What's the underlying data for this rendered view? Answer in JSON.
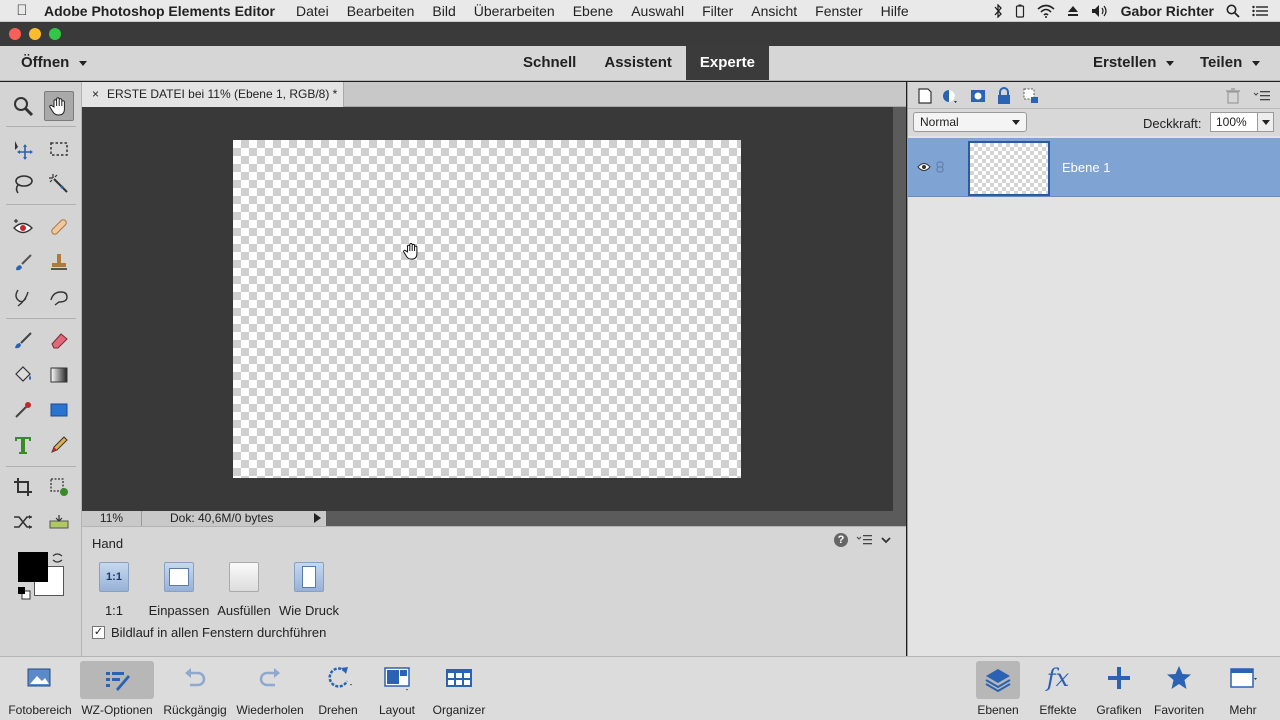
{
  "menubar": {
    "app_name": "Adobe Photoshop Elements Editor",
    "items": [
      "Datei",
      "Bearbeiten",
      "Bild",
      "Überarbeiten",
      "Ebene",
      "Auswahl",
      "Filter",
      "Ansicht",
      "Fenster",
      "Hilfe"
    ],
    "user": "Gabor Richter"
  },
  "topbar": {
    "open_label": "Öffnen",
    "modes": [
      "Schnell",
      "Assistent",
      "Experte"
    ],
    "active_mode": "Experte",
    "create_label": "Erstellen",
    "share_label": "Teilen"
  },
  "document": {
    "tab_close": "×",
    "tab_title": "ERSTE DATEI bei 11% (Ebene 1, RGB/8) *"
  },
  "status": {
    "zoom": "11%",
    "doc_info": "Dok: 40,6M/0 bytes"
  },
  "tool_options": {
    "title": "Hand",
    "help_symbol": "?",
    "buttons": [
      {
        "icon_text": "1:1",
        "label": "1:1"
      },
      {
        "icon_text": "",
        "label": "Einpassen"
      },
      {
        "icon_text": "",
        "label": "Ausfüllen"
      },
      {
        "icon_text": "",
        "label": "Wie Druck"
      }
    ],
    "checkbox_label": "Bildlauf in allen Fenstern durchführen",
    "checkbox_mark": "✓"
  },
  "layers": {
    "blend_mode": "Normal",
    "opacity_label": "Deckkraft:",
    "opacity_value": "100%",
    "layer_name": "Ebene 1"
  },
  "bottombar": {
    "fotobereich": "Fotobereich",
    "wz_optionen": "WZ-Optionen",
    "rueckgaengig": "Rückgängig",
    "wiederholen": "Wiederholen",
    "drehen": "Drehen",
    "layout": "Layout",
    "organizer": "Organizer",
    "ebenen": "Ebenen",
    "effekte": "Effekte",
    "effekte_icon_text": "fx",
    "grafiken": "Grafiken",
    "favoriten": "Favoriten",
    "mehr": "Mehr"
  }
}
